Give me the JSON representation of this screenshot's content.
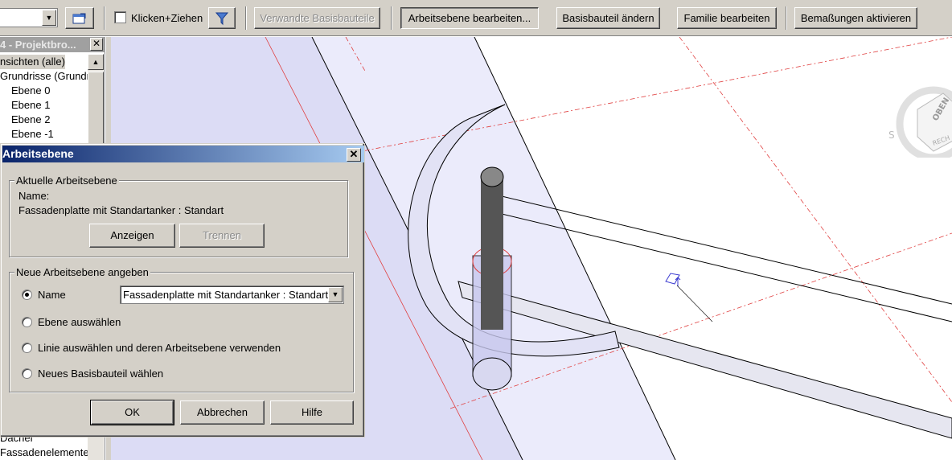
{
  "toolbar": {
    "checkbox_label": "Klicken+Ziehen",
    "related_hosts": "Verwandte Basisbauteile",
    "edit_workplane": "Arbeitsebene bearbeiten...",
    "change_host": "Basisbauteil ändern",
    "edit_family": "Familie bearbeiten",
    "activate_dimensions": "Bemaßungen aktivieren"
  },
  "browser": {
    "title": "4 - Projektbro...",
    "items": [
      "nsichten (alle)",
      "Grundrisse (Grundri",
      "Ebene 0",
      "Ebene 1",
      "Ebene 2",
      "Ebene -1",
      "Dächer",
      "Fassadenelemente"
    ]
  },
  "viewcube": {
    "top": "OBEN",
    "right": "RECH",
    "compass_s": "S"
  },
  "dialog": {
    "title": "Arbeitsebene",
    "current_group": "Aktuelle Arbeitsebene",
    "name_label": "Name:",
    "current_name": "Fassadenplatte mit Standartanker : Standart",
    "show_button": "Anzeigen",
    "separate_button": "Trennen",
    "new_group": "Neue Arbeitsebene angeben",
    "options": [
      "Name",
      "Ebene auswählen",
      "Linie auswählen und deren Arbeitsebene verwenden",
      "Neues Basisbauteil wählen"
    ],
    "selected_option": "Name",
    "combo_value": "Fassadenplatte mit Standartanker : Standart",
    "ok": "OK",
    "cancel": "Abbrechen",
    "help": "Hilfe"
  }
}
